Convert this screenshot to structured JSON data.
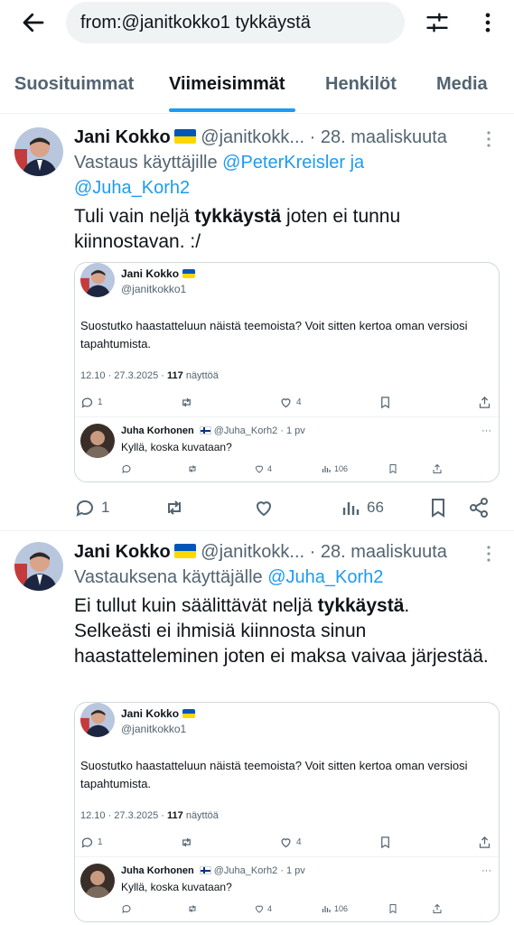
{
  "search": {
    "query": "from:@janitkokko1 tykkäystä"
  },
  "icons": {
    "back": "arrow-left-icon",
    "filter": "sliders-icon",
    "more": "more-vertical-icon"
  },
  "colors": {
    "accent": "#1d9bf0",
    "muted": "#536471",
    "text": "#0f1419",
    "flag_blue": "#0057b7",
    "flag_yellow": "#ffd700"
  },
  "tabs": [
    {
      "label": "Suosituimmat",
      "active": false
    },
    {
      "label": "Viimeisimmät",
      "active": true
    },
    {
      "label": "Henkilöt",
      "active": false
    },
    {
      "label": "Media",
      "active": false
    }
  ],
  "tweets": [
    {
      "author": "Jani Kokko",
      "handle": "@janitkokk...",
      "date": "· 28. maaliskuuta",
      "reply_prefix": "Vastaus käyttäjille",
      "reply_mentions_a": "@PeterKreisler ja",
      "reply_mentions_b": "@Juha_Korh2",
      "text_pre": "Tuli vain neljä ",
      "text_bold": "tykkäystä",
      "text_post": " joten ei tunnu kiinnostavan. :/",
      "quote": {
        "author": "Jani Kokko",
        "handle": "@janitkokko1",
        "text": "Suostutko haastatteluun näistä teemoista? Voit sitten kertoa oman versiosi tapahtumista.",
        "meta_time": "12.10 · 27.3.2025 · ",
        "meta_views": "117",
        "meta_views_label": " näyttöä",
        "replies": "1",
        "likes": "4",
        "reply": {
          "author": "Juha Korhonen",
          "handle_time": "@Juha_Korh2 · 1 pv",
          "text": "Kyllä, koska kuvataan?",
          "likes": "4",
          "views": "106",
          "more": "···"
        }
      },
      "replies": "1",
      "views": "66"
    },
    {
      "author": "Jani Kokko",
      "handle": "@janitkokk...",
      "date": "· 28. maaliskuuta",
      "reply_prefix": "Vastauksena käyttäjälle",
      "reply_mentions_a": "@Juha_Korh2",
      "text_pre": "Ei tullut kuin säälittävät neljä ",
      "text_bold": "tykkäystä",
      "text_post": ". Selkeästi ei ihmisiä kiinnosta sinun haastatteleminen joten ei maksa vaivaa järjestää.",
      "quote": {
        "author": "Jani Kokko",
        "handle": "@janitkokko1",
        "text": "Suostutko haastatteluun näistä teemoista? Voit sitten kertoa oman versiosi tapahtumista.",
        "meta_time": "12.10 · 27.3.2025 · ",
        "meta_views": "117",
        "meta_views_label": " näyttöä",
        "replies": "1",
        "likes": "4",
        "reply": {
          "author": "Juha Korhonen",
          "handle_time": "@Juha_Korh2 · 1 pv",
          "text": "Kyllä, koska kuvataan?",
          "likes": "4",
          "views": "106",
          "more": "···"
        }
      }
    }
  ]
}
